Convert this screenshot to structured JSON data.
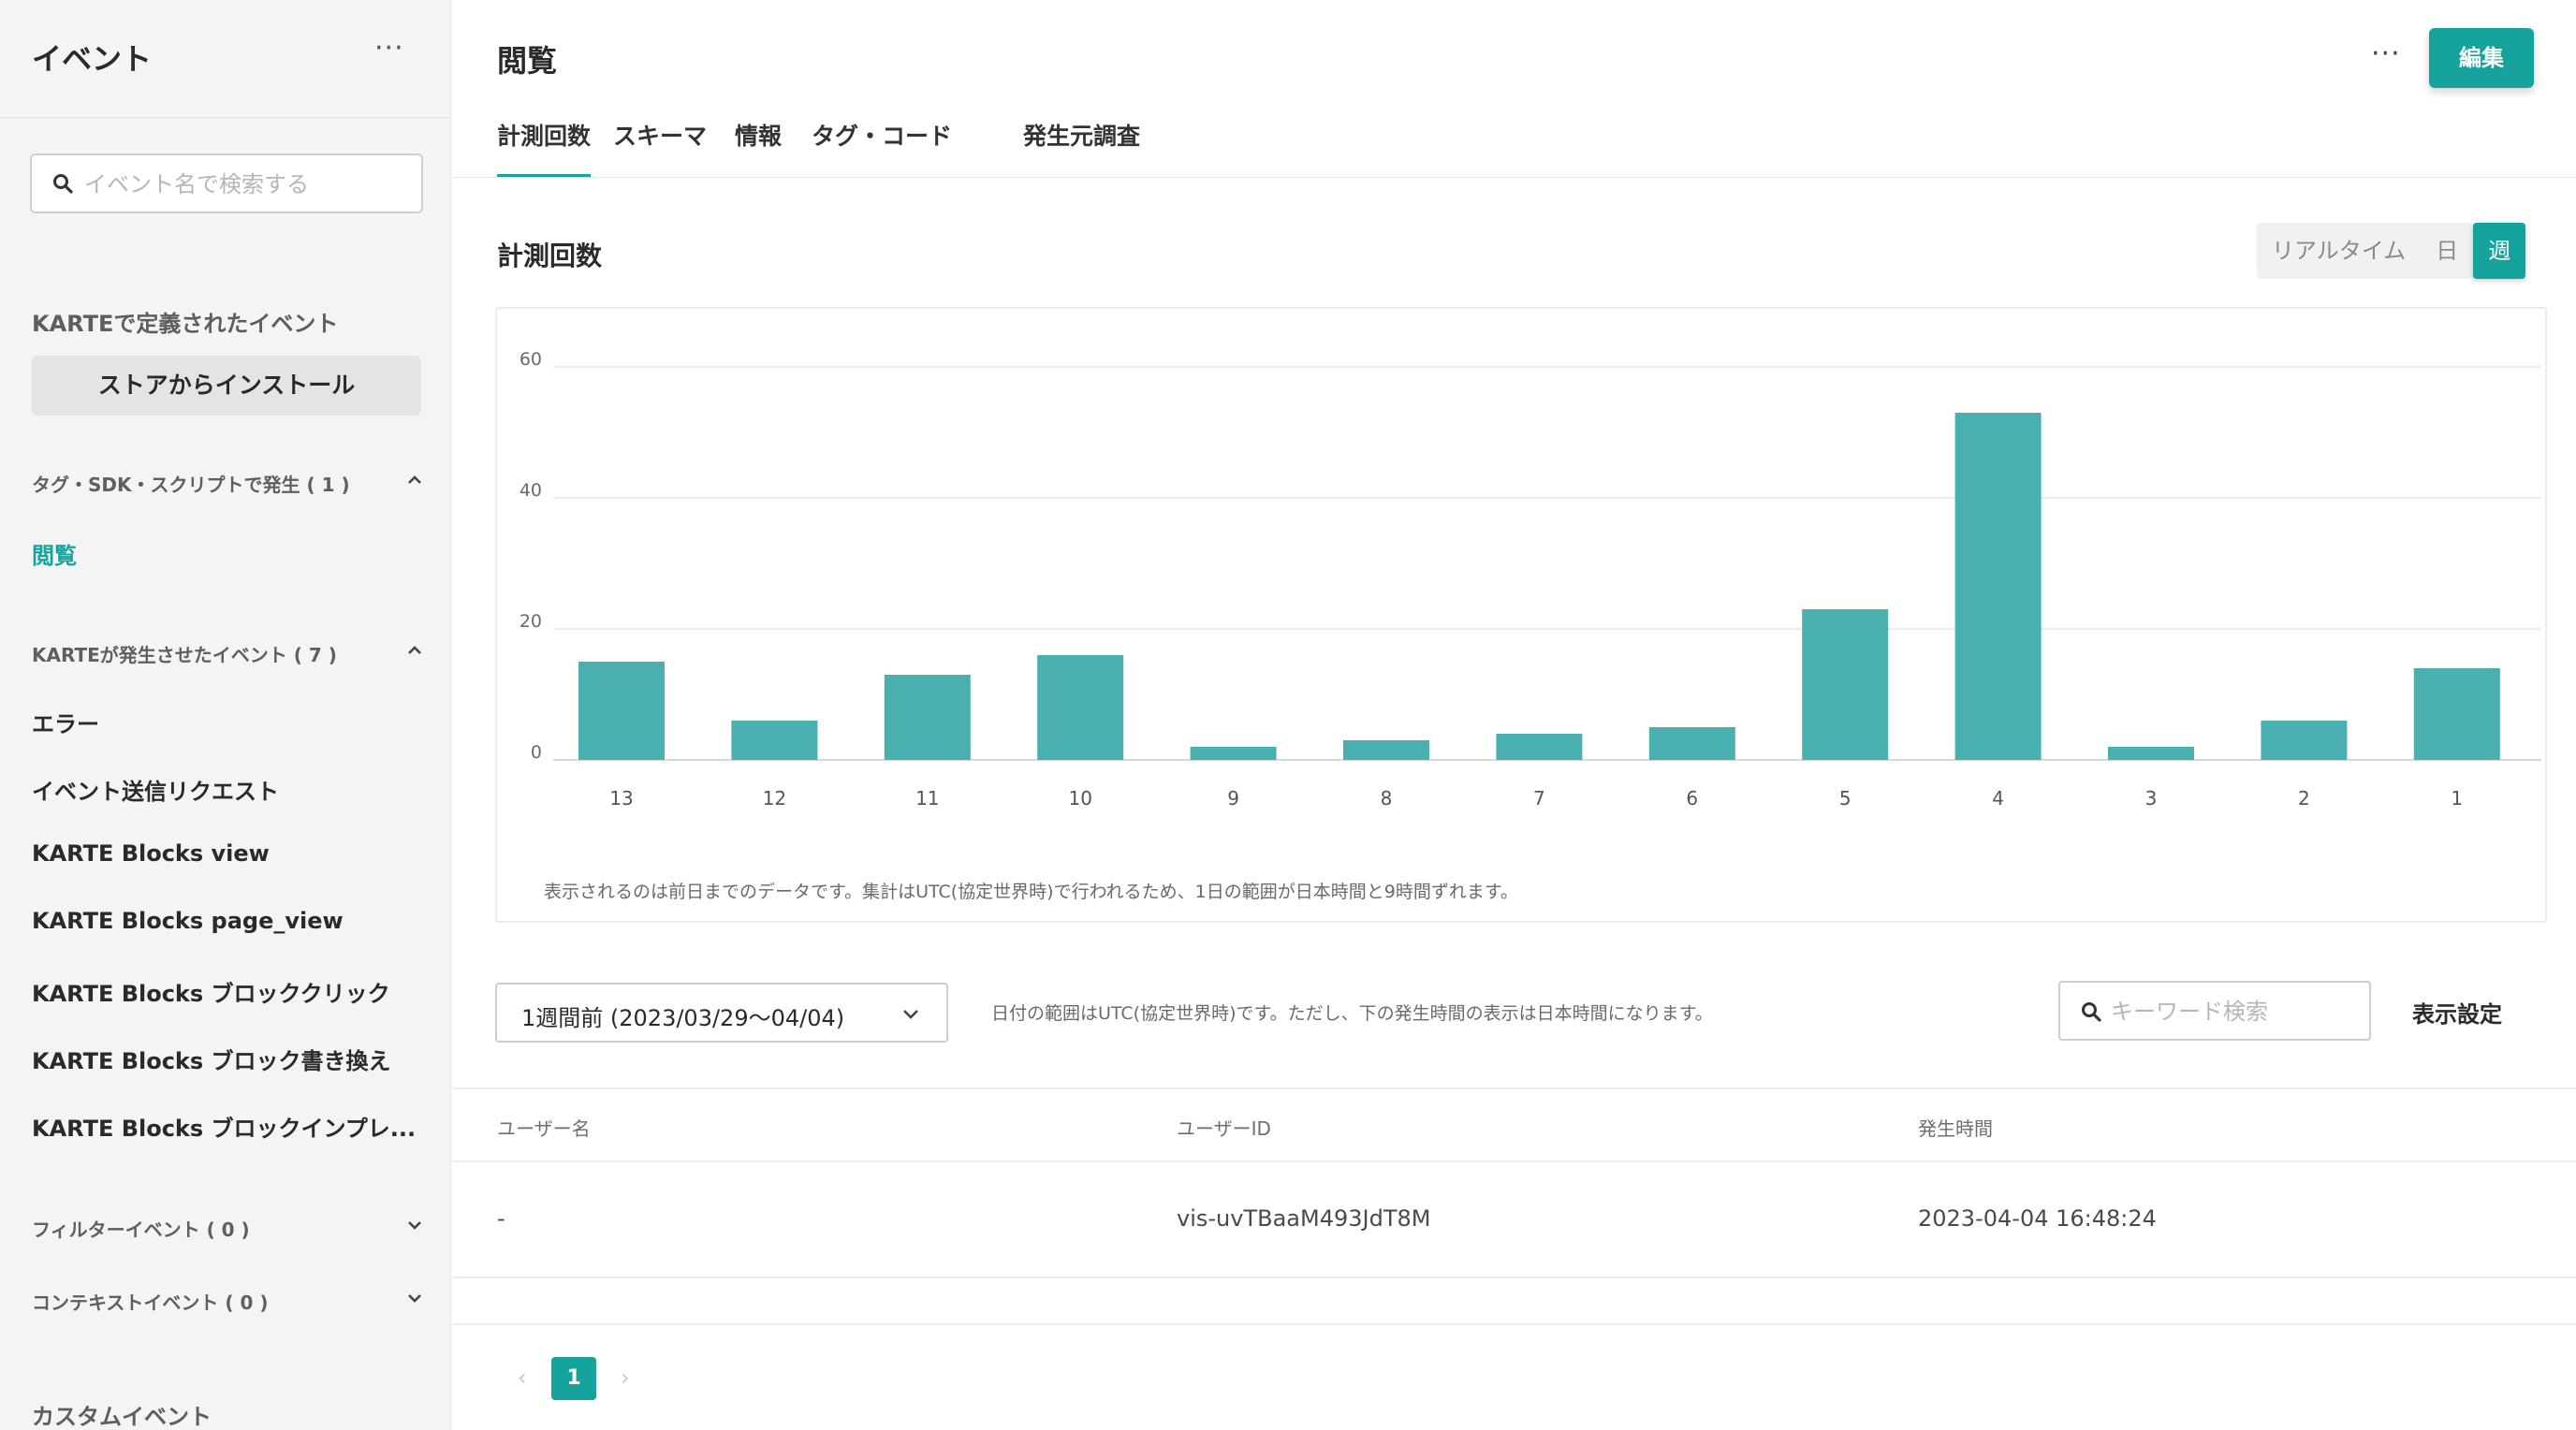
{
  "colors": {
    "accent": "#16a39e",
    "bar": "#4aafaf"
  },
  "sidebar": {
    "title": "イベント",
    "more": "···",
    "search_placeholder": "イベント名で検索する",
    "defined_heading": "KARTEで定義されたイベント",
    "install_button": "ストアからインストール",
    "group_tag": "タグ・SDK・スクリプトで発生 ( 1 )",
    "tag_items": [
      "閲覧"
    ],
    "group_karte": "KARTEが発生させたイベント ( 7 )",
    "karte_items": [
      "エラー",
      "イベント送信リクエスト",
      "KARTE Blocks view",
      "KARTE Blocks page_view",
      "KARTE Blocks ブロッククリック",
      "KARTE Blocks ブロック書き換え",
      "KARTE Blocks ブロックインプレ..."
    ],
    "group_filter": "フィルターイベント ( 0 )",
    "group_context": "コンテキストイベント ( 0 )",
    "custom_heading": "カスタムイベント"
  },
  "header": {
    "title": "閲覧",
    "more": "···",
    "edit_button": "編集",
    "tabs": [
      "計測回数",
      "スキーマ",
      "情報",
      "タグ・コード",
      "発生元調査"
    ]
  },
  "section": {
    "title": "計測回数",
    "period_options": [
      "リアルタイム",
      "日",
      "週"
    ],
    "selected_period": "週"
  },
  "chart_data": {
    "type": "bar",
    "categories": [
      "13",
      "12",
      "11",
      "10",
      "9",
      "8",
      "7",
      "6",
      "5",
      "4",
      "3",
      "2",
      "1"
    ],
    "values": [
      15,
      6,
      13,
      16,
      2,
      3,
      4,
      5,
      23,
      53,
      2,
      6,
      14
    ],
    "yticks": [
      0,
      20,
      40,
      60
    ],
    "ylim": [
      0,
      60
    ],
    "grid": true,
    "note": "表示されるのは前日までのデータです。集計はUTC(協定世界時)で行われるため、1日の範囲が日本時間と9時間ずれます。"
  },
  "filter": {
    "range_value": "1週間前 (2023/03/29〜04/04)",
    "range_note": "日付の範囲はUTC(協定世界時)です。ただし、下の発生時間の表示は日本時間になります。",
    "keyword_placeholder": "キーワード検索",
    "display_settings": "表示設定"
  },
  "table": {
    "columns": [
      "ユーザー名",
      "ユーザーID",
      "発生時間"
    ],
    "rows": [
      [
        "-",
        "vis-uvTBaaM493JdT8M",
        "2023-04-04 16:48:24"
      ]
    ]
  },
  "pagination": {
    "prev": "‹",
    "current": "1",
    "next": "›"
  }
}
